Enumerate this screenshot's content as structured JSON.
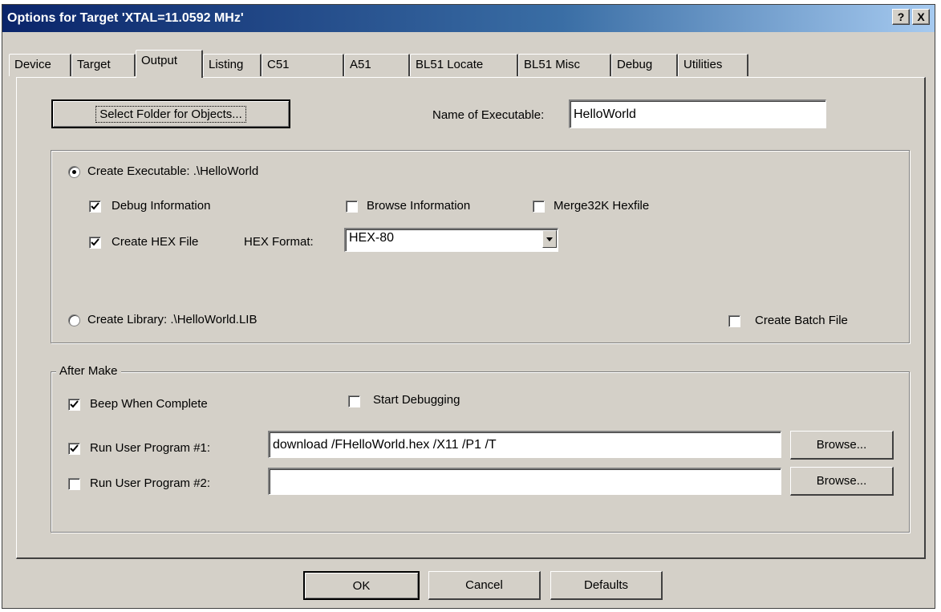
{
  "window": {
    "title": "Options for Target 'XTAL=11.0592 MHz'",
    "help_label": "?",
    "close_label": "X"
  },
  "tabs": [
    {
      "label": "Device"
    },
    {
      "label": "Target"
    },
    {
      "label": "Output",
      "active": true
    },
    {
      "label": "Listing"
    },
    {
      "label": "C51"
    },
    {
      "label": "A51"
    },
    {
      "label": "BL51 Locate"
    },
    {
      "label": "BL51 Misc"
    },
    {
      "label": "Debug"
    },
    {
      "label": "Utilities"
    }
  ],
  "output": {
    "select_folder_label": "Select Folder for Objects...",
    "name_of_executable_label": "Name of Executable:",
    "name_of_executable_value": "HelloWorld",
    "create_executable_label": "Create Executable:  .\\HelloWorld",
    "create_executable_selected": true,
    "debug_information_label": "Debug Information",
    "debug_information_checked": true,
    "browse_information_label": "Browse Information",
    "browse_information_checked": false,
    "merge32k_label": "Merge32K Hexfile",
    "merge32k_checked": false,
    "create_hex_label": "Create HEX File",
    "create_hex_checked": true,
    "hex_format_label": "HEX Format:",
    "hex_format_value": "HEX-80",
    "create_library_label": "Create Library:  .\\HelloWorld.LIB",
    "create_library_selected": false,
    "create_batch_label": "Create Batch File",
    "create_batch_checked": false
  },
  "after_make": {
    "group_label": "After Make",
    "beep_label": "Beep When Complete",
    "beep_checked": true,
    "start_debugging_label": "Start Debugging",
    "start_debugging_checked": false,
    "run1_label": "Run User Program #1:",
    "run1_checked": true,
    "run1_value": "download /FHelloWorld.hex /X11 /P1 /T",
    "run2_label": "Run User Program #2:",
    "run2_checked": false,
    "run2_value": "",
    "browse_label": "Browse..."
  },
  "footer": {
    "ok_label": "OK",
    "cancel_label": "Cancel",
    "defaults_label": "Defaults"
  }
}
